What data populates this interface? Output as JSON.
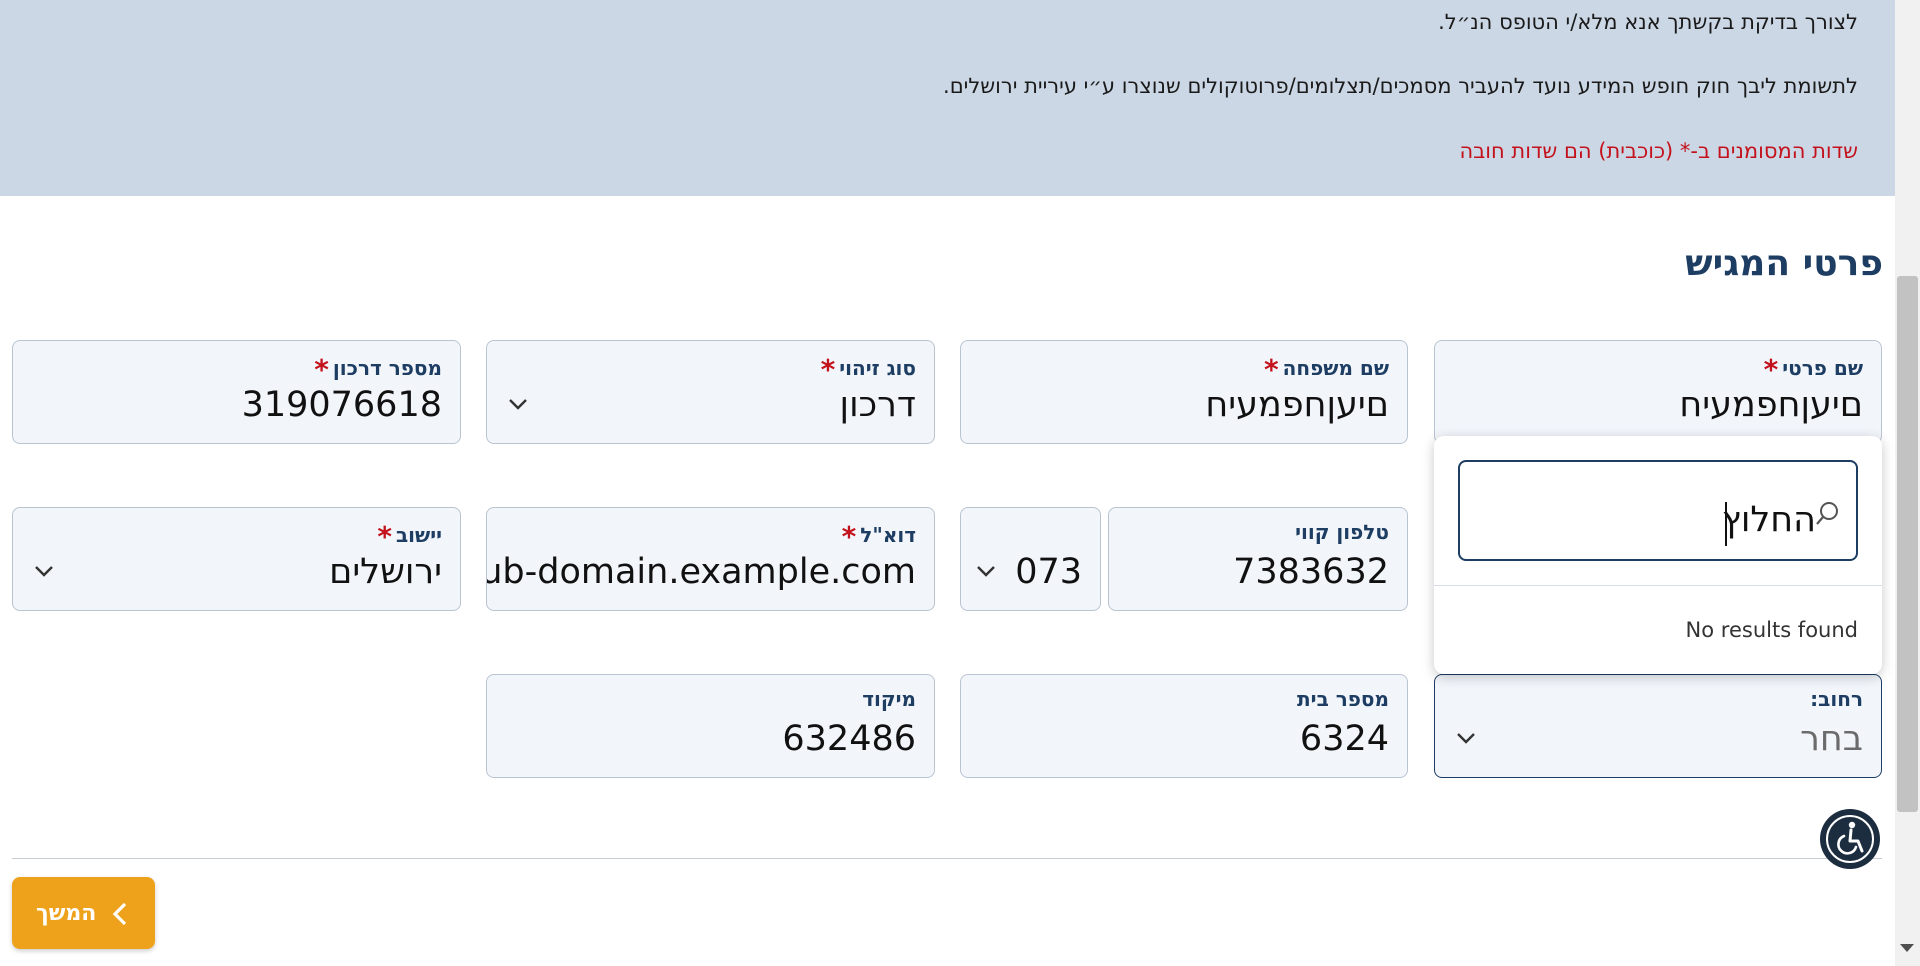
{
  "intro": {
    "line1": "לצורך בדיקת בקשתך אנא מלא/י הטופס הנ״ל.",
    "line2": "לתשומת ליבך חוק חופש המידע נועד להעביר מסמכים/תצלומים/פרוטוקולים שנוצרו ע״י עיריית ירושלים.",
    "required_note": "שדות המסומנים ב-* (כוכבית) הם שדות חובה"
  },
  "section_title": "פרטי המגיש",
  "required_mark": "*",
  "fields": {
    "first_name": {
      "label": "שם פרטי",
      "value": "םיעןחפמעיח"
    },
    "last_name": {
      "label": "שם משפחה",
      "value": "םיעןחפמעיח"
    },
    "id_type": {
      "label": "סוג זיהוי",
      "value": "דרכון"
    },
    "passport": {
      "label": "מספר דרכון",
      "value": "319076618"
    },
    "phone": {
      "label": "טלפון קווי",
      "value": "7383632",
      "prefix": "073"
    },
    "email": {
      "label": "דוא\"ל",
      "value": "@sub-domain.example.com"
    },
    "city": {
      "label": "יישוב",
      "value": "ירושלים"
    },
    "street": {
      "label": "רחוב:",
      "placeholder": "בחר"
    },
    "house_number": {
      "label": "מספר בית",
      "value": "6324"
    },
    "zip": {
      "label": "מיקוד",
      "value": "632486"
    }
  },
  "street_dropdown": {
    "search_value": "החלוץ",
    "empty_message": "No results found"
  },
  "buttons": {
    "continue": "המשך"
  },
  "colors": {
    "accent": "#eea21c",
    "primary": "#1d3d63",
    "required": "#c4121c",
    "banner": "#cbd7e5"
  },
  "icons": {
    "search": "search-icon",
    "chevron": "chevron-down-icon",
    "accessibility": "accessibility-icon",
    "back": "chevron-left-icon"
  }
}
